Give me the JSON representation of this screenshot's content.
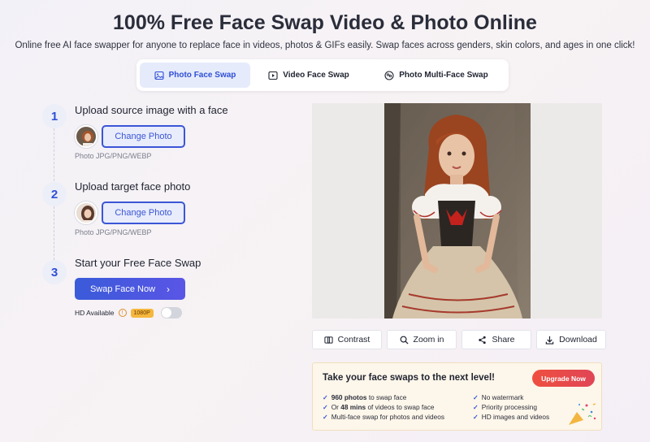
{
  "header": {
    "title": "100% Free Face Swap Video & Photo Online",
    "subtitle": "Online free AI face swapper for anyone to replace face in videos, photos & GIFs easily. Swap faces across genders, skin colors, and ages in one click!"
  },
  "tabs": [
    {
      "label": "Photo Face Swap",
      "icon": "image-icon",
      "active": true
    },
    {
      "label": "Video Face Swap",
      "icon": "video-icon",
      "active": false
    },
    {
      "label": "Photo Multi-Face Swap",
      "icon": "multi-face-icon",
      "active": false
    }
  ],
  "steps": [
    {
      "num": "1",
      "title": "Upload source image with a face",
      "button": "Change Photo",
      "hint": "Photo JPG/PNG/WEBP"
    },
    {
      "num": "2",
      "title": "Upload target face photo",
      "button": "Change Photo",
      "hint": "Photo JPG/PNG/WEBP"
    },
    {
      "num": "3",
      "title": "Start your Free Face Swap"
    }
  ],
  "swap_button": "Swap Face Now",
  "hd": {
    "label": "HD Available",
    "badge": "1080P",
    "enabled": false
  },
  "actions": [
    {
      "label": "Contrast",
      "icon": "contrast-icon"
    },
    {
      "label": "Zoom in",
      "icon": "search-icon"
    },
    {
      "label": "Share",
      "icon": "share-icon"
    },
    {
      "label": "Download",
      "icon": "download-icon"
    }
  ],
  "promo": {
    "title": "Take your face swaps to the next level!",
    "upgrade": "Upgrade Now",
    "features_left": [
      {
        "bold": "960 photos",
        "rest": " to swap face"
      },
      {
        "pre": "Or ",
        "bold": "48 mins",
        "rest": " of videos to swap face"
      },
      {
        "rest": "Multi-face swap for photos and videos"
      }
    ],
    "features_right": [
      "No watermark",
      "Priority processing",
      "HD images and videos"
    ]
  },
  "colors": {
    "accent": "#3b56d6",
    "upgrade": "#ef4f3f",
    "promo_bg": "#fdf6ea"
  }
}
